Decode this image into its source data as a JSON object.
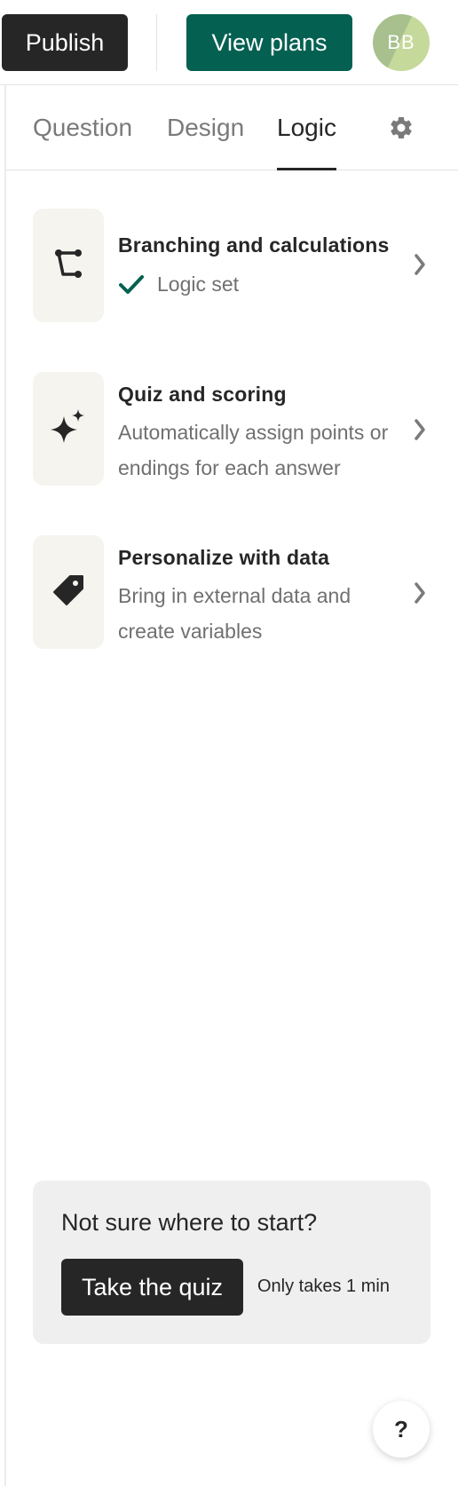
{
  "header": {
    "publish_label": "Publish",
    "view_plans_label": "View plans",
    "avatar_initials": "BB"
  },
  "tabs": [
    {
      "label": "Question",
      "active": false
    },
    {
      "label": "Design",
      "active": false
    },
    {
      "label": "Logic",
      "active": true
    }
  ],
  "settings": {
    "icon": "gear-icon"
  },
  "logic_items": [
    {
      "title": "Branching and calculations",
      "status": "Logic set",
      "icon": "branch-icon"
    },
    {
      "title": "Quiz and scoring",
      "description": "Automatically assign points or endings for each answer",
      "icon": "sparkle-icon"
    },
    {
      "title": "Personalize with data",
      "description": "Bring in external data and create variables",
      "icon": "tag-icon"
    }
  ],
  "help_card": {
    "title": "Not sure where to start?",
    "button_label": "Take the quiz",
    "note": "Only takes 1 min"
  },
  "help_fab": {
    "label": "?"
  },
  "colors": {
    "publish_bg": "#262627",
    "plans_bg": "#046151",
    "check": "#046151",
    "icon_box": "#f5f4ef",
    "help_card_bg": "#efefef"
  }
}
